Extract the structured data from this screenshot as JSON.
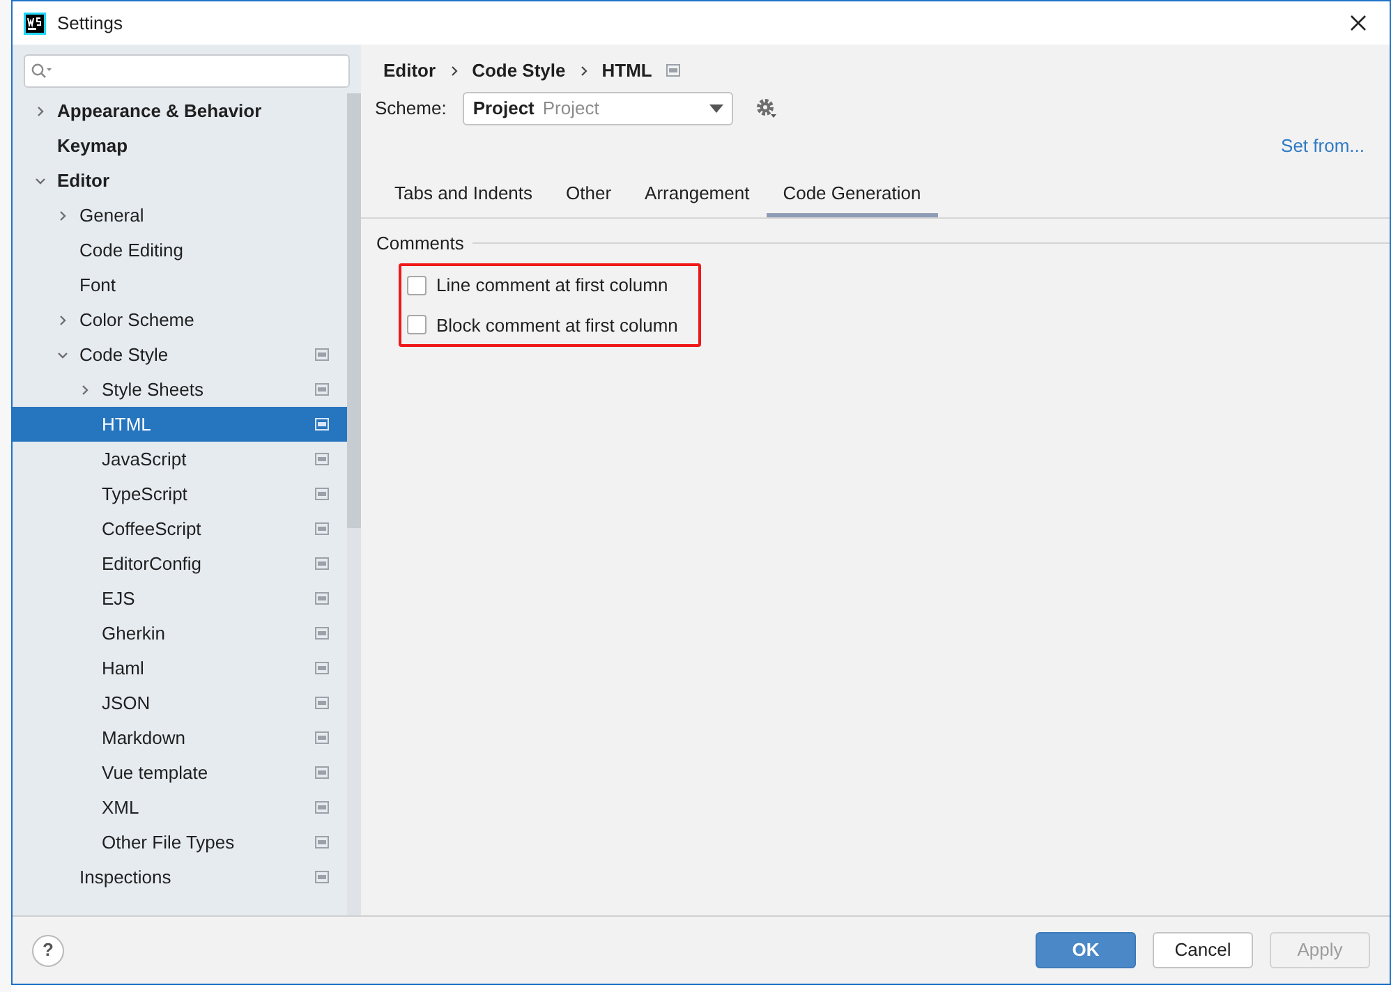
{
  "window": {
    "title": "Settings"
  },
  "sidebar": {
    "tree": [
      {
        "label": "Appearance & Behavior",
        "kind": "folder",
        "expanded": false,
        "selected": false,
        "scheme_icon": false
      },
      {
        "label": "Keymap",
        "kind": "page",
        "selected": false,
        "scheme_icon": false
      },
      {
        "label": "Editor",
        "kind": "folder",
        "expanded": true,
        "selected": false,
        "scheme_icon": false,
        "children": [
          {
            "label": "General",
            "kind": "folder",
            "expanded": false,
            "selected": false,
            "scheme_icon": false
          },
          {
            "label": "Code Editing",
            "kind": "page",
            "selected": false,
            "scheme_icon": false
          },
          {
            "label": "Font",
            "kind": "page",
            "selected": false,
            "scheme_icon": false
          },
          {
            "label": "Color Scheme",
            "kind": "folder",
            "expanded": false,
            "selected": false,
            "scheme_icon": false
          },
          {
            "label": "Code Style",
            "kind": "folder",
            "expanded": true,
            "selected": false,
            "scheme_icon": true,
            "children": [
              {
                "label": "Style Sheets",
                "kind": "folder",
                "expanded": false,
                "selected": false,
                "scheme_icon": true
              },
              {
                "label": "HTML",
                "kind": "page",
                "selected": true,
                "scheme_icon": true
              },
              {
                "label": "JavaScript",
                "kind": "page",
                "selected": false,
                "scheme_icon": true
              },
              {
                "label": "TypeScript",
                "kind": "page",
                "selected": false,
                "scheme_icon": true
              },
              {
                "label": "CoffeeScript",
                "kind": "page",
                "selected": false,
                "scheme_icon": true
              },
              {
                "label": "EditorConfig",
                "kind": "page",
                "selected": false,
                "scheme_icon": true
              },
              {
                "label": "EJS",
                "kind": "page",
                "selected": false,
                "scheme_icon": true
              },
              {
                "label": "Gherkin",
                "kind": "page",
                "selected": false,
                "scheme_icon": true
              },
              {
                "label": "Haml",
                "kind": "page",
                "selected": false,
                "scheme_icon": true
              },
              {
                "label": "JSON",
                "kind": "page",
                "selected": false,
                "scheme_icon": true
              },
              {
                "label": "Markdown",
                "kind": "page",
                "selected": false,
                "scheme_icon": true
              },
              {
                "label": "Vue template",
                "kind": "page",
                "selected": false,
                "scheme_icon": true
              },
              {
                "label": "XML",
                "kind": "page",
                "selected": false,
                "scheme_icon": true
              },
              {
                "label": "Other File Types",
                "kind": "page",
                "selected": false,
                "scheme_icon": true
              }
            ]
          },
          {
            "label": "Inspections",
            "kind": "page",
            "selected": false,
            "scheme_icon": true
          }
        ]
      }
    ]
  },
  "breadcrumb": [
    "Editor",
    "Code Style",
    "HTML"
  ],
  "scheme": {
    "label": "Scheme:",
    "name": "Project",
    "type": "Project"
  },
  "set_from": "Set from...",
  "tabs": [
    {
      "label": "Tabs and Indents",
      "selected": false
    },
    {
      "label": "Other",
      "selected": false
    },
    {
      "label": "Arrangement",
      "selected": false
    },
    {
      "label": "Code Generation",
      "selected": true
    }
  ],
  "section": {
    "title": "Comments",
    "options": [
      {
        "label": "Line comment at first column",
        "checked": false
      },
      {
        "label": "Block comment at first column",
        "checked": false
      }
    ]
  },
  "help": "?",
  "buttons": [
    {
      "label": "OK",
      "kind": "primary",
      "disabled": false
    },
    {
      "label": "Cancel",
      "kind": "normal",
      "disabled": false
    },
    {
      "label": "Apply",
      "kind": "normal",
      "disabled": true
    }
  ]
}
